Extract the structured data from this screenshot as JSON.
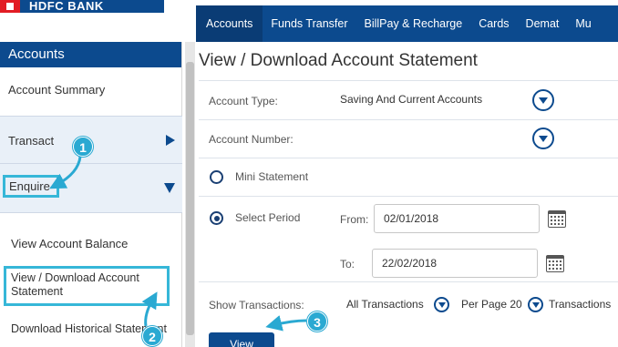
{
  "brand": {
    "name": "HDFC BANK",
    "color": "#0c4a8e",
    "accent": "#e21c24"
  },
  "nav": {
    "items": [
      {
        "label": "Accounts",
        "active": true
      },
      {
        "label": "Funds Transfer"
      },
      {
        "label": "BillPay & Recharge"
      },
      {
        "label": "Cards"
      },
      {
        "label": "Demat"
      },
      {
        "label": "Mu"
      }
    ]
  },
  "sidebar": {
    "header": "Accounts",
    "items": [
      {
        "label": "Account Summary"
      },
      {
        "label": "Transact"
      },
      {
        "label": "Enquire"
      },
      {
        "label": "View Account Balance"
      },
      {
        "label": "View / Download Account Statement"
      },
      {
        "label": "Download Historical Statement"
      }
    ]
  },
  "main": {
    "title": "View / Download Account Statement",
    "account_type_label": "Account Type:",
    "account_type_value": "Saving And Current Accounts",
    "account_number_label": "Account Number:",
    "mini_statement_label": "Mini Statement",
    "select_period_label": "Select Period",
    "from_label": "From:",
    "from_value": "02/01/2018",
    "to_label": "To:",
    "to_value": "22/02/2018",
    "show_transactions_label": "Show Transactions:",
    "show_transactions_value": "All Transactions",
    "per_page_label": "Per Page 20",
    "transactions_label": "Transactions",
    "view_button": "View"
  },
  "callouts": {
    "one": "1",
    "two": "2",
    "three": "3",
    "color": "#2aa9d2"
  }
}
